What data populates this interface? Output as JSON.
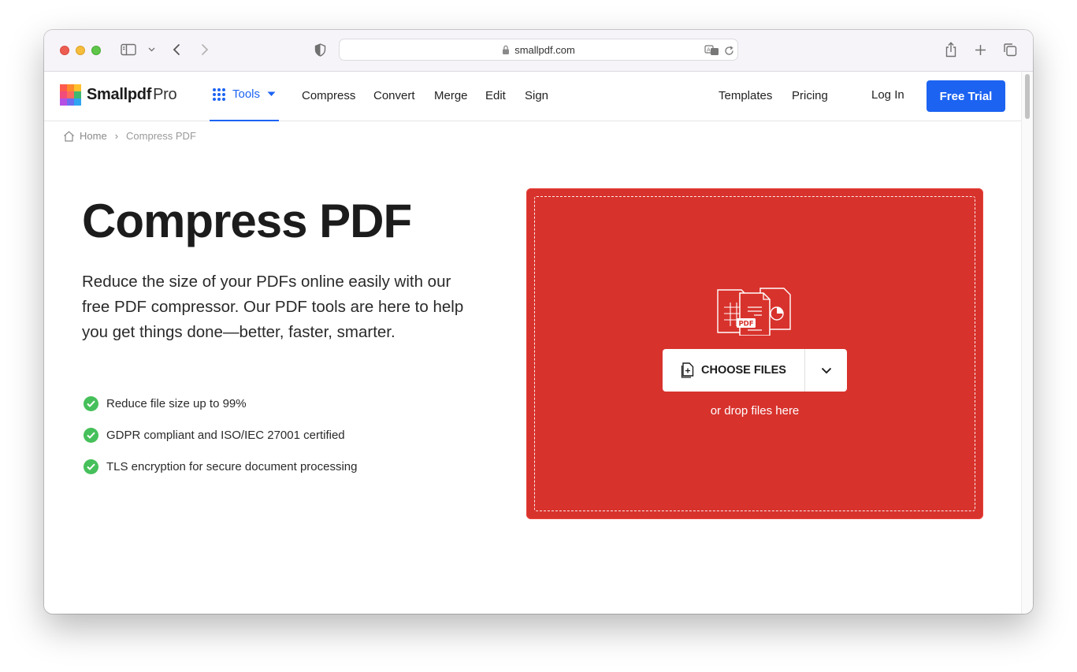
{
  "browser": {
    "url": "smallpdf.com",
    "icons": [
      "sidebar-icon",
      "chevron-down-icon",
      "back-icon",
      "forward-icon",
      "shield-icon",
      "lock-icon",
      "translate-icon",
      "reload-icon",
      "share-icon",
      "new-tab-icon",
      "tabs-overview-icon"
    ]
  },
  "nav": {
    "logo_name": "Smallpdf",
    "logo_suffix": "Pro",
    "tools_label": "Tools",
    "links": [
      "Compress",
      "Convert",
      "Merge",
      "Edit",
      "Sign"
    ],
    "templates_label": "Templates",
    "pricing_label": "Pricing",
    "login_label": "Log In",
    "cta_label": "Free Trial"
  },
  "breadcrumb": {
    "home": "Home",
    "separator": "›",
    "current": "Compress PDF"
  },
  "hero": {
    "title": "Compress PDF",
    "description": "Reduce the size of your PDFs online easily with our free PDF compressor. Our PDF tools are here to help you get things done—better, faster, smarter.",
    "features": [
      "Reduce file size up to 99%",
      "GDPR compliant and ISO/IEC 27001 certified",
      "TLS encryption for secure document processing"
    ]
  },
  "dropzone": {
    "button_label": "CHOOSE FILES",
    "hint": "or drop files here",
    "illustration_badge": "PDF"
  },
  "colors": {
    "brand_blue": "#1c63f2",
    "dropzone_red": "#d8322c",
    "check_green": "#46c05a"
  }
}
